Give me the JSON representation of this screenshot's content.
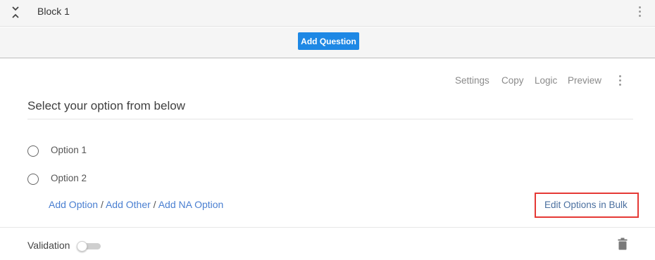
{
  "block": {
    "title": "Block 1",
    "add_question_label": "Add Question"
  },
  "question": {
    "toolbar": {
      "settings": "Settings",
      "copy": "Copy",
      "logic": "Logic",
      "preview": "Preview"
    },
    "title": "Select your option from below",
    "options": [
      {
        "label": "Option 1",
        "selected": false
      },
      {
        "label": "Option 2",
        "selected": false
      }
    ],
    "add_links": {
      "add_option": "Add Option",
      "sep1": " / ",
      "add_other": "Add Other",
      "sep2": " / ",
      "add_na": "Add NA Option"
    },
    "edit_bulk": "Edit Options in Bulk",
    "validation": {
      "label": "Validation",
      "enabled": false
    }
  },
  "colors": {
    "accent_button": "#1e88e5",
    "link": "#4a7fd1",
    "highlight_border": "#e53935"
  },
  "icons": [
    "collapse-icon",
    "kebab-menu-icon",
    "trash-icon"
  ]
}
